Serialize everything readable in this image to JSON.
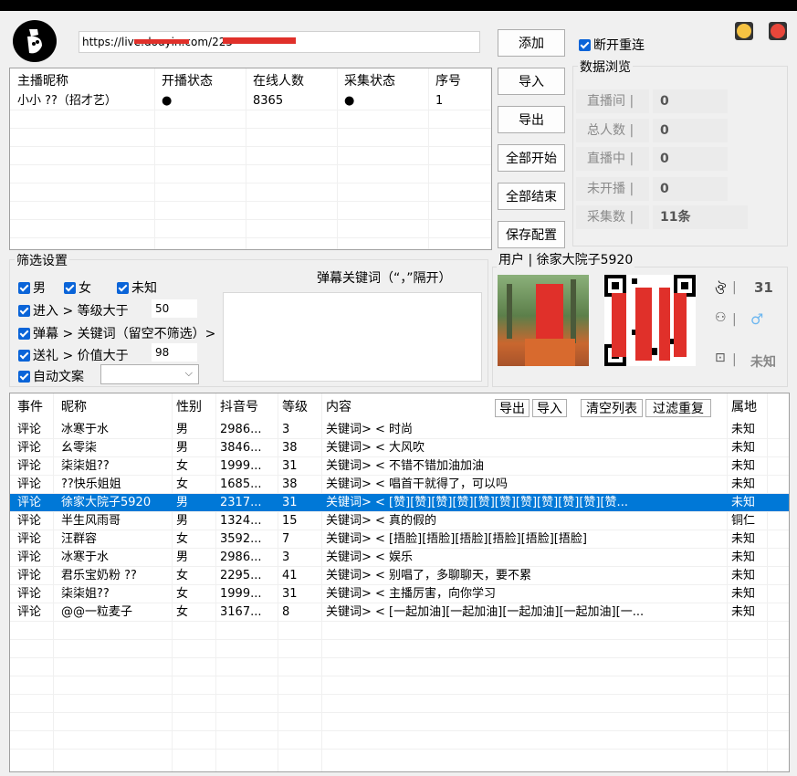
{
  "top": {
    "url_value": "https://live.douyin.com/225",
    "add_label": "添加",
    "reconnect_label": "断开重连",
    "colors": {
      "yellow": "#f5c242",
      "red": "#e8473b"
    }
  },
  "streamer_table": {
    "headers": [
      "主播昵称",
      "开播状态",
      "在线人数",
      "采集状态",
      "序号"
    ],
    "rows": [
      {
        "name": "小小 ??（招才艺）",
        "live": "●",
        "online": "8365",
        "collect": "●",
        "index": "1"
      }
    ]
  },
  "buttons": {
    "import": "导入",
    "export": "导出",
    "start_all": "全部开始",
    "stop_all": "全部结束",
    "save_config": "保存配置"
  },
  "stats": {
    "title": "数据浏览",
    "items": [
      {
        "label": "直播间 |",
        "value": "0"
      },
      {
        "label": "总人数 |",
        "value": "0"
      },
      {
        "label": "直播中 |",
        "value": "0"
      },
      {
        "label": "未开播 |",
        "value": "0"
      },
      {
        "label": "采集数 |",
        "value": "11条"
      }
    ]
  },
  "filter": {
    "title": "筛选设置",
    "male": "男",
    "female": "女",
    "unknown": "未知",
    "enter_label": "进入 > 等级大于",
    "enter_value": "50",
    "danmu_label": "弹幕 > 关键词（留空不筛选）>",
    "gift_label": "送礼 > 价值大于",
    "gift_value": "98",
    "auto_label": "自动文案",
    "keyword_title": "弹幕关键词（“，”隔开）"
  },
  "user": {
    "title": "用户 | 徐家大院子5920",
    "level_prefix": "|",
    "level_value": "31",
    "location_prefix": "|",
    "location_value": "未知"
  },
  "events": {
    "headers": [
      "事件",
      "昵称",
      "性别",
      "抖音号",
      "等级",
      "内容",
      "属地"
    ],
    "export": "导出",
    "import": "导入",
    "clear": "清空列表",
    "dedupe": "过滤重复",
    "rows": [
      {
        "event": "评论",
        "nick": "冰寒于水",
        "gender": "男",
        "id": "2986...",
        "level": "3",
        "content": "关键词> < 时尚",
        "region": "未知"
      },
      {
        "event": "评论",
        "nick": "幺零柒",
        "gender": "男",
        "id": "3846...",
        "level": "38",
        "content": "关键词> < 大风吹",
        "region": "未知"
      },
      {
        "event": "评论",
        "nick": "柒柒姐??",
        "gender": "女",
        "id": "1999...",
        "level": "31",
        "content": "关键词> < 不错不错加油加油",
        "region": "未知"
      },
      {
        "event": "评论",
        "nick": "??快乐姐姐",
        "gender": "女",
        "id": "1685...",
        "level": "38",
        "content": "关键词> < 唱首干就得了，可以吗",
        "region": "未知"
      },
      {
        "event": "评论",
        "nick": "徐家大院子5920",
        "gender": "男",
        "id": "2317...",
        "level": "31",
        "content": "关键词> < [赞][赞][赞][赞][赞][赞][赞][赞][赞][赞][赞...",
        "region": "未知"
      },
      {
        "event": "评论",
        "nick": "半生风雨哥",
        "gender": "男",
        "id": "1324...",
        "level": "15",
        "content": "关键词> < 真的假的",
        "region": "铜仁"
      },
      {
        "event": "评论",
        "nick": "汪群容",
        "gender": "女",
        "id": "3592...",
        "level": "7",
        "content": "关键词> < [捂脸][捂脸][捂脸][捂脸][捂脸][捂脸]",
        "region": "未知"
      },
      {
        "event": "评论",
        "nick": "冰寒于水",
        "gender": "男",
        "id": "2986...",
        "level": "3",
        "content": "关键词> < 娱乐",
        "region": "未知"
      },
      {
        "event": "评论",
        "nick": "君乐宝奶粉 ??",
        "gender": "女",
        "id": "2295...",
        "level": "41",
        "content": "关键词> < 别唱了，多聊聊天，要不累",
        "region": "未知"
      },
      {
        "event": "评论",
        "nick": "柒柒姐??",
        "gender": "女",
        "id": "1999...",
        "level": "31",
        "content": "关键词> < 主播厉害，向你学习",
        "region": "未知"
      },
      {
        "event": "评论",
        "nick": "@@一粒麦子",
        "gender": "女",
        "id": "3167...",
        "level": "8",
        "content": "关键词> < [一起加油][一起加油][一起加油][一起加油][一...",
        "region": "未知"
      }
    ],
    "selected_index": 4
  }
}
